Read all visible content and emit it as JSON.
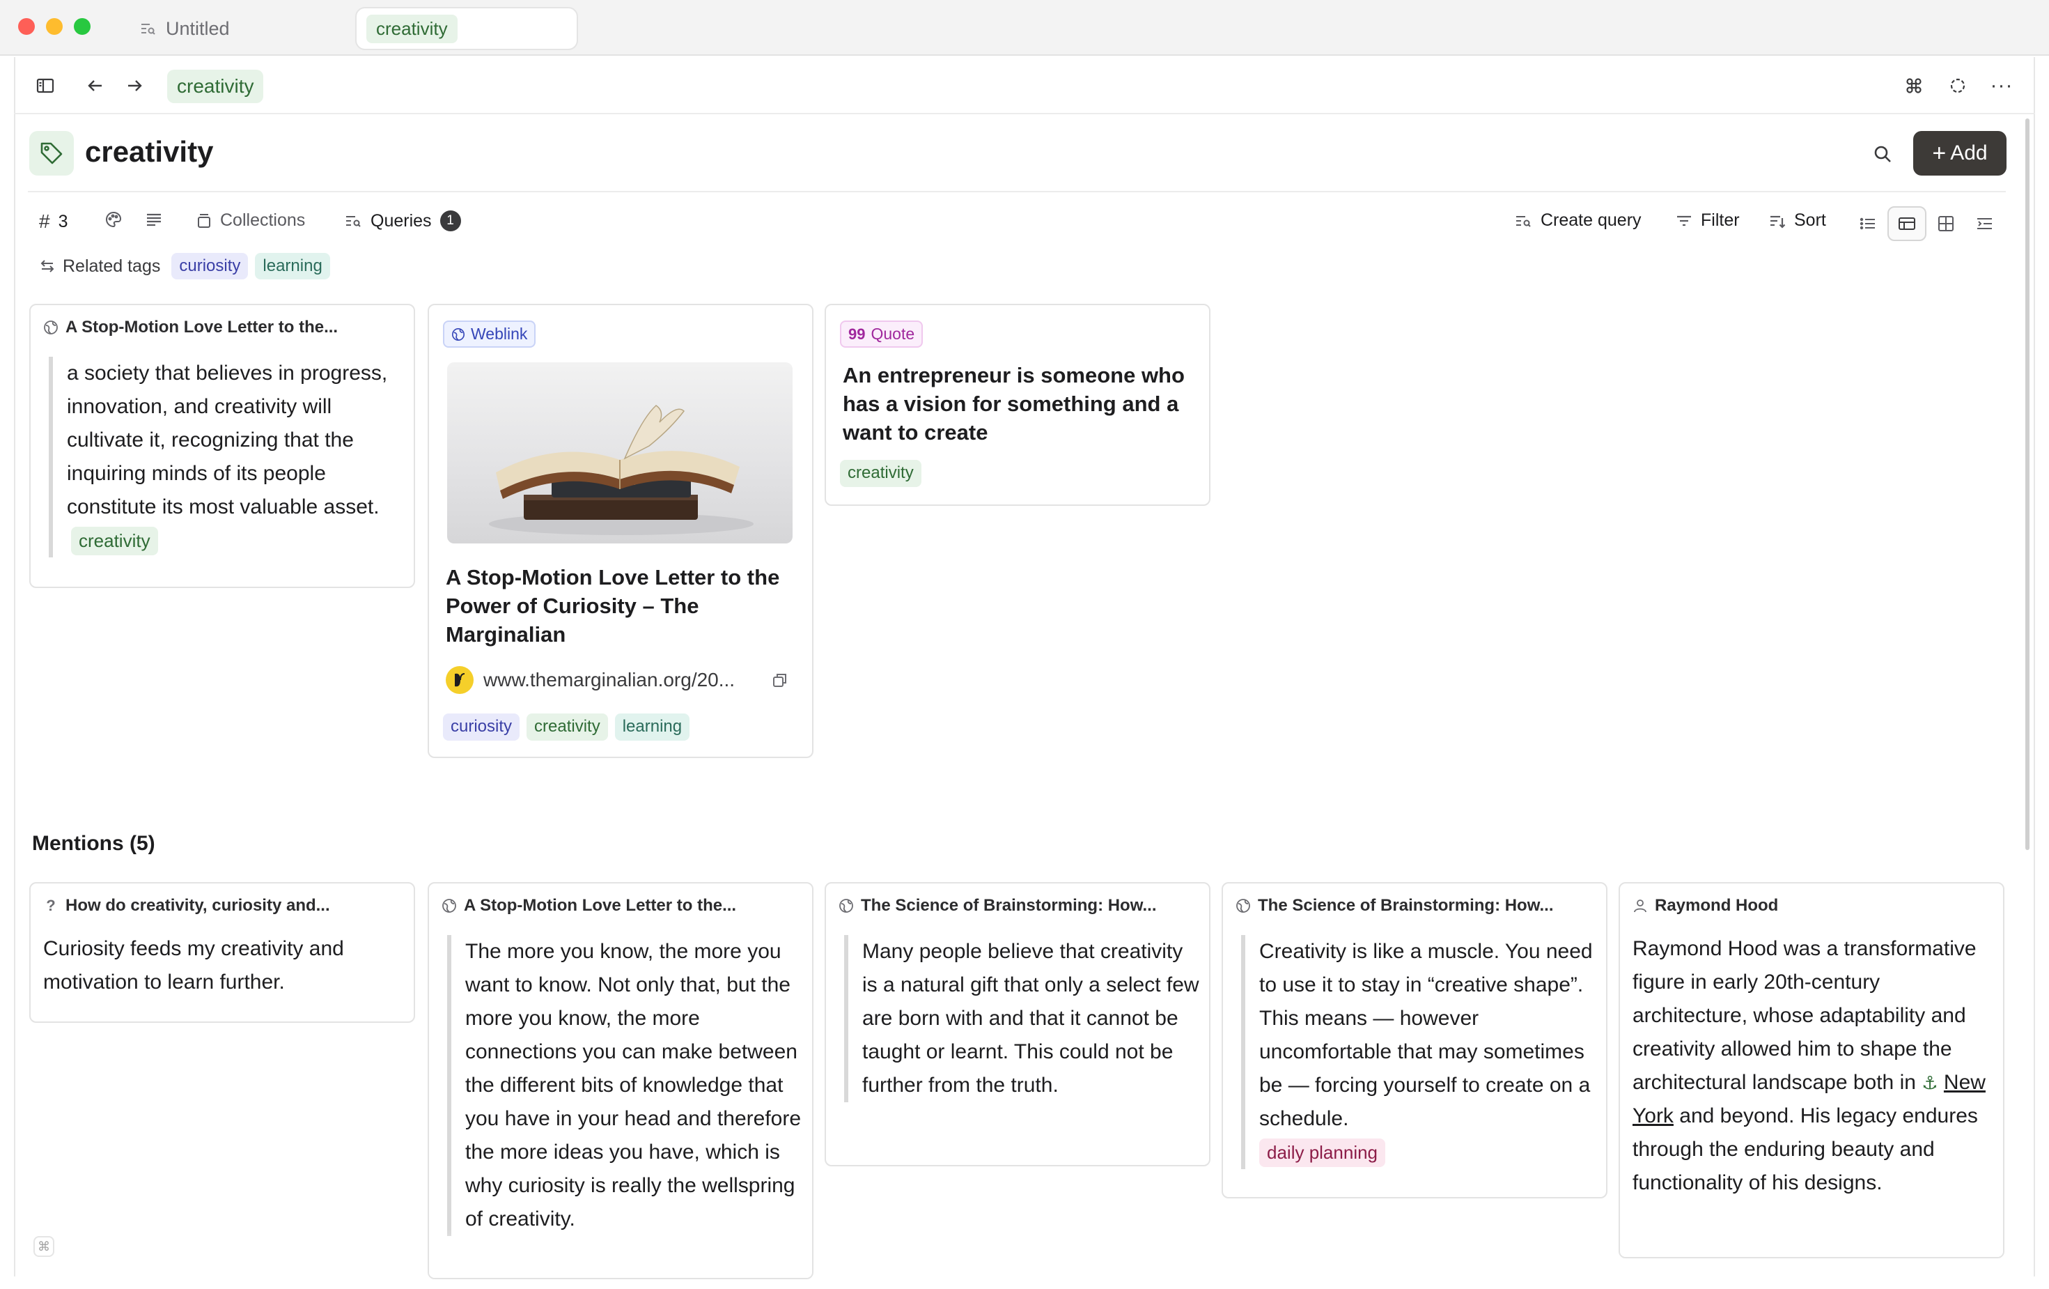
{
  "tabs": [
    {
      "label": "Untitled",
      "icon": "query-icon"
    },
    {
      "label": "creativity",
      "icon": "tag-chip"
    }
  ],
  "nav": {
    "breadcrumb": "creativity"
  },
  "page": {
    "title": "creativity",
    "add_label": "Add"
  },
  "toolbar": {
    "count": "3",
    "collections_label": "Collections",
    "queries_label": "Queries",
    "queries_count": "1",
    "create_query_label": "Create query",
    "filter_label": "Filter",
    "sort_label": "Sort"
  },
  "related": {
    "label": "Related tags",
    "tags": [
      "curiosity",
      "learning"
    ]
  },
  "cards": {
    "highlight": {
      "source": "A Stop-Motion Love Letter to the...",
      "quote": "a society that believes in progress, innovation, and creativity will cultivate it, recognizing that the inquiring minds of its people constitute its most valuable asset.",
      "tag": "creativity"
    },
    "weblink": {
      "type": "Weblink",
      "title": "A Stop-Motion Love Letter to the Power of Curiosity – The Marginalian",
      "url": "www.themarginalian.org/20...",
      "tags": [
        "curiosity",
        "creativity",
        "learning"
      ]
    },
    "quote": {
      "type": "Quote",
      "text": "An entrepreneur is someone who has a vision for something and a want to create",
      "tag": "creativity"
    }
  },
  "mentions": {
    "title": "Mentions (5)",
    "items": [
      {
        "source": "How do creativity, curiosity and...",
        "icon": "question-icon",
        "text": "Curiosity feeds my creativity and motivation to learn further."
      },
      {
        "source": "A Stop-Motion Love Letter to the...",
        "icon": "globe-icon",
        "text": "The more you know, the more you want to know. Not only that, but the more you know, the more connections you can make between the different bits of knowledge that you have in your head and therefore the more ideas you have, which is why curiosity is really the wellspring of creativity."
      },
      {
        "source": "The Science of Brainstorming: How...",
        "icon": "globe-icon",
        "text": "Many people believe that creativity is a natural gift that only a select few are born with and that it cannot be taught or learnt. This could not be further from the truth."
      },
      {
        "source": "The Science of Brainstorming: How...",
        "icon": "globe-icon",
        "text": "Creativity is like a muscle. You need to use it to stay in “creative shape”. This means — however uncomfortable that may sometimes be — forcing yourself to create on a schedule.",
        "tag": "daily planning"
      },
      {
        "source": "Raymond Hood",
        "icon": "person-icon",
        "text_before": "Raymond Hood was a transformative figure in early 20th-century architecture, whose adaptability and creativity allowed him to shape the architectural landscape both in",
        "link": "New York",
        "text_after": "and beyond. His legacy endures through the enduring beauty and functionality of his designs."
      }
    ]
  },
  "colors": {
    "accent_green": "#2f6b35",
    "chip_green_bg": "#e7f3e8",
    "add_button_bg": "#3d3a37",
    "weblink_blue": "#3546b8",
    "quote_purple": "#a0289d",
    "planning_pink": "#8c1d48"
  }
}
